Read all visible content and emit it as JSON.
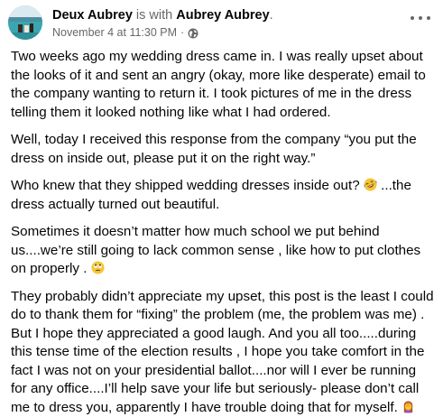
{
  "post": {
    "author": "Deux Aubrey",
    "with_text": " is with ",
    "tagged": "Aubrey Aubrey",
    "period": ".",
    "timestamp": "November 4 at 11:30 PM",
    "separator": "·",
    "privacy_icon": "globe-icon",
    "more_icon": "more-options-icon",
    "paragraphs": [
      {
        "text": "Two weeks ago my wedding dress came in. I was really upset about the looks of it and sent an angry (okay, more like desperate)  email to the company wanting to return it. I took pictures of me in the dress telling them it looked nothing like what I had ordered."
      },
      {
        "text": "Well, today I received this response from the company “you put the dress on inside out, please put it on the right way.”"
      },
      {
        "before": "Who knew that they shipped wedding dresses inside out? ",
        "emoji": "rofl-emoji",
        "after": " ...the dress actually turned out beautiful."
      },
      {
        "before": "Sometimes it doesn’t matter how much school we put behind us....we’re still going to lack common sense , like how to put clothes on properly . ",
        "emoji": "eye-roll-emoji",
        "after": ""
      },
      {
        "before": "They probably didn’t appreciate my upset, this post is the least I could do to thank them for “fixing” the problem (me, the problem was me) . But I hope they appreciated a good laugh. And you all too.....during this tense time of the election results , I hope you take comfort in the fact I was not on your presidential ballot....nor will I ever be running for any office....I’ll help save your life but seriously- please don’t call me to dress you, apparently I have trouble doing that for myself. ",
        "emoji": "woman-facepalming-emoji",
        "after": ""
      }
    ]
  },
  "colors": {
    "text": "#050505",
    "secondary": "#65676b",
    "background": "#ffffff"
  }
}
